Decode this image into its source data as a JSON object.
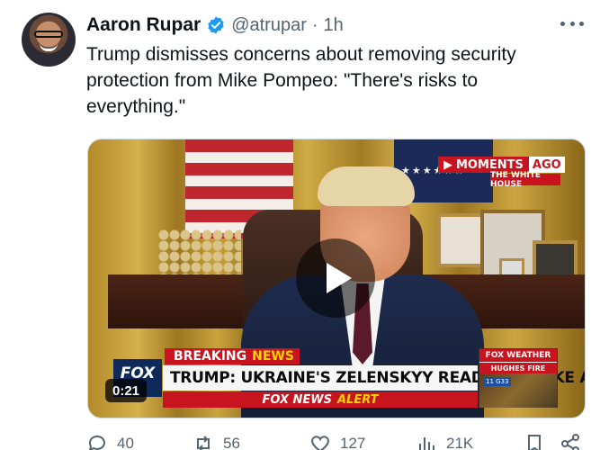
{
  "author": {
    "name": "Aaron Rupar",
    "handle": "@atrupar",
    "separator": "·",
    "time": "1h"
  },
  "tweet": {
    "text": "Trump dismisses concerns about removing security protection from Mike Pompeo: \"There's risks to everything.\""
  },
  "video": {
    "duration": "0:21",
    "overlay": {
      "moments_left": "MOMENTS",
      "moments_right": "AGO",
      "location": "THE WHITE HOUSE",
      "breaking_left": "BREAKING",
      "breaking_right": "NEWS",
      "headline": "TRUMP: UKRAINE'S ZELENSKYY READY TO MAKE A DEAL",
      "alert_left": "FOX NEWS",
      "alert_right": "ALERT",
      "fox_logo": "FOX",
      "weather_title": "FOX WEATHER",
      "weather_sub": "HUGHES FIRE",
      "weather_tag": "11 G33"
    }
  },
  "actions": [
    {
      "icon": "reply-icon",
      "count": "40"
    },
    {
      "icon": "retweet-icon",
      "count": "56"
    },
    {
      "icon": "like-icon",
      "count": "127"
    },
    {
      "icon": "views-icon",
      "count": "21K"
    },
    {
      "icon": "bookmark-icon",
      "count": ""
    },
    {
      "icon": "share-icon",
      "count": ""
    }
  ],
  "colors": {
    "text_primary": "#0f1419",
    "text_secondary": "#536471",
    "verified_blue": "#1d9bf0",
    "fox_red": "#c8141f"
  }
}
